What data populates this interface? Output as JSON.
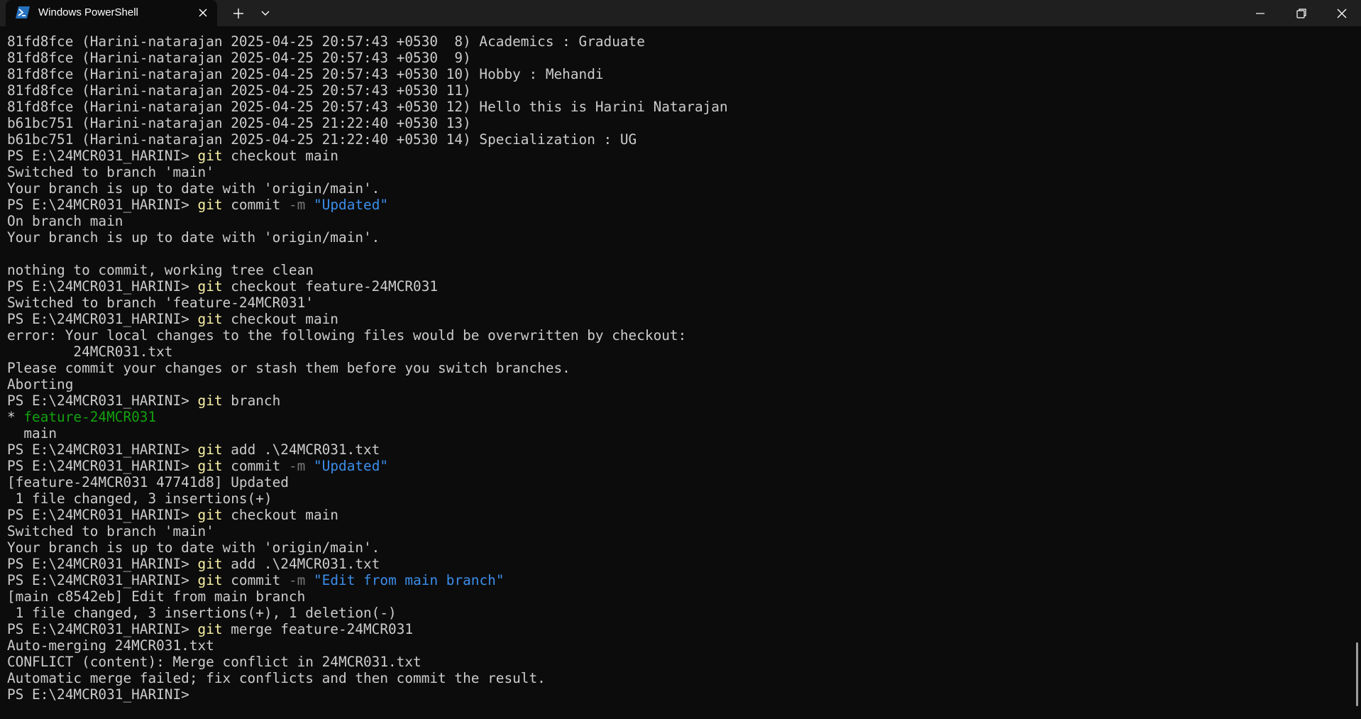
{
  "window": {
    "tab_title": "Windows PowerShell",
    "icons": {
      "tab": "powershell-icon",
      "close_tab": "close-icon",
      "new_tab": "plus-icon",
      "dropdown": "chevron-down-icon",
      "minimize": "minimize-icon",
      "maximize": "restore-icon",
      "close_window": "close-icon"
    }
  },
  "colors": {
    "background": "#0c0c0c",
    "titlebar": "#1f1f1f",
    "text": "#cccccc",
    "command": "#f9f1a5",
    "flag": "#767676",
    "string": "#3b8eea",
    "current_branch": "#13a10e"
  },
  "terminal": {
    "lines": [
      [
        {
          "t": "81fd8fce (Harini-natarajan 2025-04-25 20:57:43 +0530  8) Academics : Graduate",
          "c": "out"
        }
      ],
      [
        {
          "t": "81fd8fce (Harini-natarajan 2025-04-25 20:57:43 +0530  9)",
          "c": "out"
        }
      ],
      [
        {
          "t": "81fd8fce (Harini-natarajan 2025-04-25 20:57:43 +0530 10) Hobby : Mehandi",
          "c": "out"
        }
      ],
      [
        {
          "t": "81fd8fce (Harini-natarajan 2025-04-25 20:57:43 +0530 11)",
          "c": "out"
        }
      ],
      [
        {
          "t": "81fd8fce (Harini-natarajan 2025-04-25 20:57:43 +0530 12) Hello this is Harini Natarajan",
          "c": "out"
        }
      ],
      [
        {
          "t": "b61bc751 (Harini-natarajan 2025-04-25 21:22:40 +0530 13)",
          "c": "out"
        }
      ],
      [
        {
          "t": "b61bc751 (Harini-natarajan 2025-04-25 21:22:40 +0530 14) Specialization : UG",
          "c": "out"
        }
      ],
      [
        {
          "t": "PS E:\\24MCR031_HARINI> ",
          "c": "prompt"
        },
        {
          "t": "git",
          "c": "cmd"
        },
        {
          "t": " checkout main",
          "c": "out"
        }
      ],
      [
        {
          "t": "Switched to branch 'main'",
          "c": "out"
        }
      ],
      [
        {
          "t": "Your branch is up to date with 'origin/main'.",
          "c": "out"
        }
      ],
      [
        {
          "t": "PS E:\\24MCR031_HARINI> ",
          "c": "prompt"
        },
        {
          "t": "git",
          "c": "cmd"
        },
        {
          "t": " commit ",
          "c": "out"
        },
        {
          "t": "-m",
          "c": "flag"
        },
        {
          "t": " ",
          "c": "out"
        },
        {
          "t": "\"Updated\"",
          "c": "str"
        }
      ],
      [
        {
          "t": "On branch main",
          "c": "out"
        }
      ],
      [
        {
          "t": "Your branch is up to date with 'origin/main'.",
          "c": "out"
        }
      ],
      [
        {
          "t": "",
          "c": "out"
        }
      ],
      [
        {
          "t": "nothing to commit, working tree clean",
          "c": "out"
        }
      ],
      [
        {
          "t": "PS E:\\24MCR031_HARINI> ",
          "c": "prompt"
        },
        {
          "t": "git",
          "c": "cmd"
        },
        {
          "t": " checkout feature-24MCR031",
          "c": "out"
        }
      ],
      [
        {
          "t": "Switched to branch 'feature-24MCR031'",
          "c": "out"
        }
      ],
      [
        {
          "t": "PS E:\\24MCR031_HARINI> ",
          "c": "prompt"
        },
        {
          "t": "git",
          "c": "cmd"
        },
        {
          "t": " checkout main",
          "c": "out"
        }
      ],
      [
        {
          "t": "error: Your local changes to the following files would be overwritten by checkout:",
          "c": "out"
        }
      ],
      [
        {
          "t": "        24MCR031.txt",
          "c": "out"
        }
      ],
      [
        {
          "t": "Please commit your changes or stash them before you switch branches.",
          "c": "out"
        }
      ],
      [
        {
          "t": "Aborting",
          "c": "out"
        }
      ],
      [
        {
          "t": "PS E:\\24MCR031_HARINI> ",
          "c": "prompt"
        },
        {
          "t": "git",
          "c": "cmd"
        },
        {
          "t": " branch",
          "c": "out"
        }
      ],
      [
        {
          "t": "* ",
          "c": "out"
        },
        {
          "t": "feature-24MCR031",
          "c": "branch-current"
        }
      ],
      [
        {
          "t": "  main",
          "c": "out"
        }
      ],
      [
        {
          "t": "PS E:\\24MCR031_HARINI> ",
          "c": "prompt"
        },
        {
          "t": "git",
          "c": "cmd"
        },
        {
          "t": " add .\\24MCR031.txt",
          "c": "out"
        }
      ],
      [
        {
          "t": "PS E:\\24MCR031_HARINI> ",
          "c": "prompt"
        },
        {
          "t": "git",
          "c": "cmd"
        },
        {
          "t": " commit ",
          "c": "out"
        },
        {
          "t": "-m",
          "c": "flag"
        },
        {
          "t": " ",
          "c": "out"
        },
        {
          "t": "\"Updated\"",
          "c": "str"
        }
      ],
      [
        {
          "t": "[feature-24MCR031 47741d8] Updated",
          "c": "out"
        }
      ],
      [
        {
          "t": " 1 file changed, 3 insertions(+)",
          "c": "out"
        }
      ],
      [
        {
          "t": "PS E:\\24MCR031_HARINI> ",
          "c": "prompt"
        },
        {
          "t": "git",
          "c": "cmd"
        },
        {
          "t": " checkout main",
          "c": "out"
        }
      ],
      [
        {
          "t": "Switched to branch 'main'",
          "c": "out"
        }
      ],
      [
        {
          "t": "Your branch is up to date with 'origin/main'.",
          "c": "out"
        }
      ],
      [
        {
          "t": "PS E:\\24MCR031_HARINI> ",
          "c": "prompt"
        },
        {
          "t": "git",
          "c": "cmd"
        },
        {
          "t": " add .\\24MCR031.txt",
          "c": "out"
        }
      ],
      [
        {
          "t": "PS E:\\24MCR031_HARINI> ",
          "c": "prompt"
        },
        {
          "t": "git",
          "c": "cmd"
        },
        {
          "t": " commit ",
          "c": "out"
        },
        {
          "t": "-m",
          "c": "flag"
        },
        {
          "t": " ",
          "c": "out"
        },
        {
          "t": "\"Edit from main branch\"",
          "c": "str"
        }
      ],
      [
        {
          "t": "[main c8542eb] Edit from main branch",
          "c": "out"
        }
      ],
      [
        {
          "t": " 1 file changed, 3 insertions(+), 1 deletion(-)",
          "c": "out"
        }
      ],
      [
        {
          "t": "PS E:\\24MCR031_HARINI> ",
          "c": "prompt"
        },
        {
          "t": "git",
          "c": "cmd"
        },
        {
          "t": " merge feature-24MCR031",
          "c": "out"
        }
      ],
      [
        {
          "t": "Auto-merging 24MCR031.txt",
          "c": "out"
        }
      ],
      [
        {
          "t": "CONFLICT (content): Merge conflict in 24MCR031.txt",
          "c": "out"
        }
      ],
      [
        {
          "t": "Automatic merge failed; fix conflicts and then commit the result.",
          "c": "out"
        }
      ],
      [
        {
          "t": "PS E:\\24MCR031_HARINI> ",
          "c": "prompt"
        }
      ]
    ]
  }
}
